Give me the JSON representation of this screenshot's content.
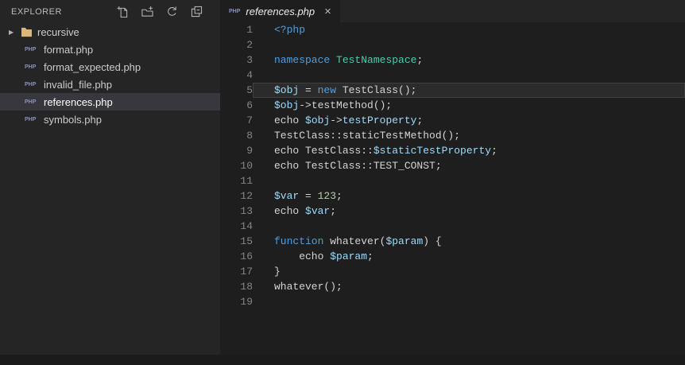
{
  "colors": {
    "editor_bg": "#1e1e1e",
    "sidebar_bg": "#252526",
    "tabbar_bg": "#252526",
    "selection_bg": "#37373d",
    "text": "#d4d4d4",
    "keyword": "#569cd6",
    "variable": "#9cdcfe",
    "class_name": "#4ec9b0",
    "number": "#b5cea8",
    "line_number": "#858585",
    "php_icon": "#8892bf",
    "folder_icon": "#dcb67a"
  },
  "explorer": {
    "title": "EXPLORER",
    "actions": [
      {
        "name": "new-file"
      },
      {
        "name": "new-folder"
      },
      {
        "name": "refresh"
      },
      {
        "name": "collapse-all"
      }
    ],
    "tree": [
      {
        "type": "folder",
        "label": "recursive",
        "collapsed": true
      },
      {
        "type": "file",
        "label": "format.php"
      },
      {
        "type": "file",
        "label": "format_expected.php"
      },
      {
        "type": "file",
        "label": "invalid_file.php"
      },
      {
        "type": "file",
        "label": "references.php",
        "selected": true
      },
      {
        "type": "file",
        "label": "symbols.php"
      }
    ]
  },
  "icons": {
    "php_badge": "PHP",
    "folder_chevron": "▶",
    "close_glyph": "×"
  },
  "tab": {
    "label": "references.php",
    "preview": true
  },
  "editor": {
    "lines": [
      {
        "n": 1,
        "tokens": [
          [
            "k",
            "<?php"
          ]
        ]
      },
      {
        "n": 2,
        "tokens": []
      },
      {
        "n": 3,
        "tokens": [
          [
            "k",
            "namespace"
          ],
          [
            "d",
            " "
          ],
          [
            "t",
            "TestNamespace"
          ],
          [
            "d",
            ";"
          ]
        ]
      },
      {
        "n": 4,
        "tokens": []
      },
      {
        "n": 5,
        "current": true,
        "tokens": [
          [
            "v",
            "$obj"
          ],
          [
            "d",
            " = "
          ],
          [
            "k",
            "new"
          ],
          [
            "d",
            " TestClass();"
          ]
        ]
      },
      {
        "n": 6,
        "tokens": [
          [
            "v",
            "$obj"
          ],
          [
            "d",
            "->testMethod();"
          ]
        ]
      },
      {
        "n": 7,
        "tokens": [
          [
            "d",
            "echo "
          ],
          [
            "v",
            "$obj"
          ],
          [
            "d",
            "->"
          ],
          [
            "v",
            "testProperty"
          ],
          [
            "d",
            ";"
          ]
        ]
      },
      {
        "n": 8,
        "tokens": [
          [
            "d",
            "TestClass::staticTestMethod();"
          ]
        ]
      },
      {
        "n": 9,
        "tokens": [
          [
            "d",
            "echo TestClass::"
          ],
          [
            "v",
            "$staticTestProperty"
          ],
          [
            "d",
            ";"
          ]
        ]
      },
      {
        "n": 10,
        "tokens": [
          [
            "d",
            "echo TestClass::TEST_CONST;"
          ]
        ]
      },
      {
        "n": 11,
        "tokens": []
      },
      {
        "n": 12,
        "tokens": [
          [
            "v",
            "$var"
          ],
          [
            "d",
            " = "
          ],
          [
            "n",
            "123"
          ],
          [
            "d",
            ";"
          ]
        ]
      },
      {
        "n": 13,
        "tokens": [
          [
            "d",
            "echo "
          ],
          [
            "v",
            "$var"
          ],
          [
            "d",
            ";"
          ]
        ]
      },
      {
        "n": 14,
        "tokens": []
      },
      {
        "n": 15,
        "tokens": [
          [
            "k",
            "function"
          ],
          [
            "d",
            " whatever("
          ],
          [
            "v",
            "$param"
          ],
          [
            "d",
            ") {"
          ]
        ]
      },
      {
        "n": 16,
        "tokens": [
          [
            "d",
            "    echo "
          ],
          [
            "v",
            "$param"
          ],
          [
            "d",
            ";"
          ]
        ]
      },
      {
        "n": 17,
        "tokens": [
          [
            "d",
            "}"
          ]
        ]
      },
      {
        "n": 18,
        "tokens": [
          [
            "d",
            "whatever();"
          ]
        ]
      },
      {
        "n": 19,
        "tokens": []
      }
    ]
  }
}
